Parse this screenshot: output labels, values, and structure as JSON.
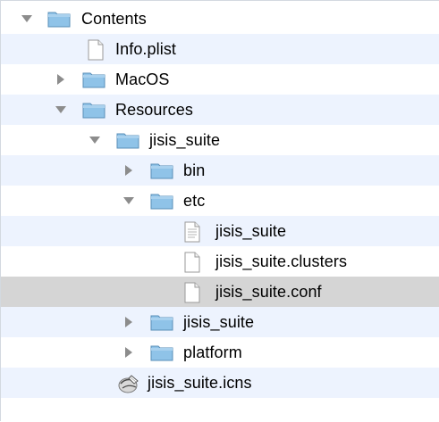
{
  "colors": {
    "row_alt": "#edf3fe",
    "row_selected": "#d5d5d5",
    "folder_fill": "#8fc3e8",
    "disclosure": "#8c8c8c"
  },
  "tree": [
    {
      "label": "Contents",
      "icon": "folder-icon",
      "state": "expanded"
    },
    {
      "label": "Info.plist",
      "icon": "document-icon",
      "state": "none"
    },
    {
      "label": "MacOS",
      "icon": "folder-icon",
      "state": "collapsed"
    },
    {
      "label": "Resources",
      "icon": "folder-icon",
      "state": "expanded"
    },
    {
      "label": "jisis_suite",
      "icon": "folder-icon",
      "state": "expanded"
    },
    {
      "label": "bin",
      "icon": "folder-icon",
      "state": "collapsed"
    },
    {
      "label": "etc",
      "icon": "folder-icon",
      "state": "expanded"
    },
    {
      "label": "jisis_suite",
      "icon": "text-document-icon",
      "state": "none"
    },
    {
      "label": "jisis_suite.clusters",
      "icon": "document-icon",
      "state": "none"
    },
    {
      "label": "jisis_suite.conf",
      "icon": "document-icon",
      "state": "none",
      "selected": true
    },
    {
      "label": "jisis_suite",
      "icon": "folder-icon",
      "state": "collapsed"
    },
    {
      "label": "platform",
      "icon": "folder-icon",
      "state": "collapsed"
    },
    {
      "label": "jisis_suite.icns",
      "icon": "icns-icon",
      "state": "none"
    }
  ]
}
